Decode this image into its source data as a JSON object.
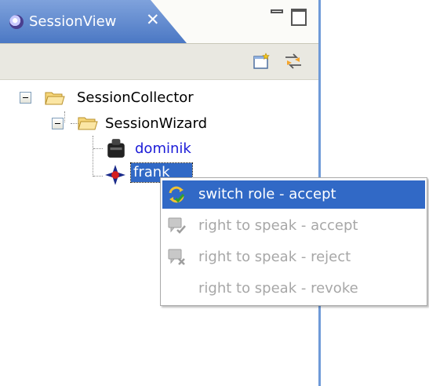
{
  "view": {
    "tab_title": "SessionView",
    "close_glyph": "✕",
    "icons": {
      "tab": "eclipse-icon",
      "minimize": "minimize-icon",
      "maximize": "maximize-icon"
    }
  },
  "toolbar": {
    "buttons": [
      {
        "icon": "new-session-icon"
      },
      {
        "icon": "switch-role-icon"
      }
    ]
  },
  "tree": {
    "root": {
      "label": "SessionCollector",
      "expanded": true,
      "icon": "folder-open-icon"
    },
    "child": {
      "label": "SessionWizard",
      "expanded": true,
      "icon": "folder-open-icon"
    },
    "users": [
      {
        "label": "dominik",
        "icon": "user-black-icon",
        "selected": false
      },
      {
        "label": "frank",
        "icon": "user-cross-icon",
        "selected": true
      }
    ]
  },
  "context_menu": {
    "items": [
      {
        "label": "switch role - accept",
        "icon": "switch-role-icon",
        "state": "active"
      },
      {
        "label": "right to speak - accept",
        "icon": "speak-accept-icon",
        "state": "disabled"
      },
      {
        "label": "right to speak - reject",
        "icon": "speak-reject-icon",
        "state": "disabled"
      },
      {
        "label": "right to speak - revoke",
        "icon": "",
        "state": "disabled"
      }
    ]
  },
  "colors": {
    "tab_gradient_top": "#7fa2dc",
    "tab_gradient_bottom": "#4b78c4",
    "selection": "#3169c6",
    "user_text": "#1b1bd8",
    "disabled_text": "#a7a7a7"
  }
}
